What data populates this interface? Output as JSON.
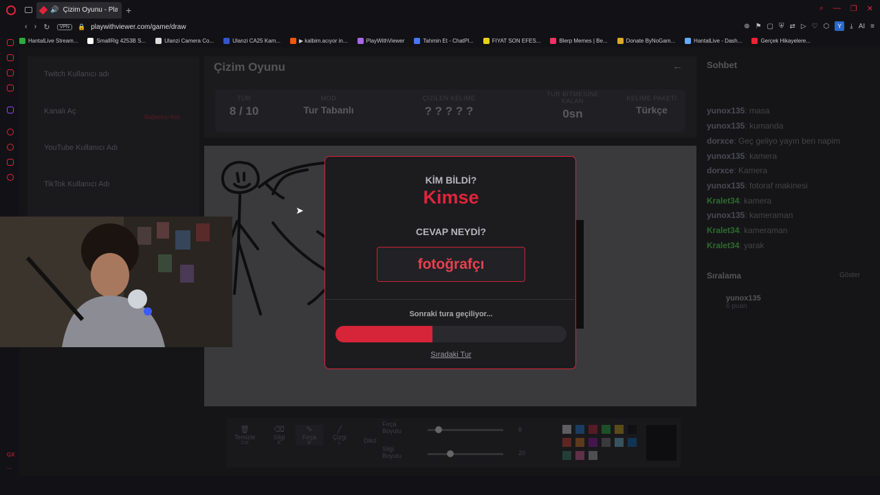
{
  "browser": {
    "tab_title": "Çizim Oyunu - PlayWi",
    "url": "playwithviewer.com/game/draw",
    "vpn_label": "VPN",
    "ai_label": "AI",
    "profile_letter": "Y"
  },
  "bookmarks": [
    {
      "label": "HantalLive Stream...",
      "color": "#2eaa3a"
    },
    {
      "label": "SmallRig 4253B S...",
      "color": "#ffffff"
    },
    {
      "label": "Ulanzi Camera Co...",
      "color": "#dddddd"
    },
    {
      "label": "Ulanzi CA25 Kam...",
      "color": "#3355cc"
    },
    {
      "label": "▶ kalbim.acıyor in...",
      "color": "#ff5500"
    },
    {
      "label": "PlayWithViewer",
      "color": "#aa66ee"
    },
    {
      "label": "Tahmin Et - ChatPl...",
      "color": "#4477ff"
    },
    {
      "label": "FIYAT SON EFES...",
      "color": "#e6d21a"
    },
    {
      "label": "Blerp Memes | Be...",
      "color": "#ee3366"
    },
    {
      "label": "Donate ByNoGam...",
      "color": "#ddaa22"
    },
    {
      "label": "HantalLive - Dash...",
      "color": "#66aaff"
    },
    {
      "label": "Gerçek Hikayelere...",
      "color": "#ee2233"
    }
  ],
  "sidebar_bottom": {
    "label": "GX",
    "more": "..."
  },
  "left_panel": {
    "twitch_label": "Twitch Kullanıcı adı",
    "channel_label": "Kanalı Aç",
    "connected_hint": "Bağlantıyı Kes",
    "youtube_label": "YouTube Kullanıcı Adı",
    "tiktok_label": "TikTok Kullanıcı Adı"
  },
  "game": {
    "title": "Çizim Oyunu",
    "stats": [
      {
        "label": "TUR",
        "value": "8 / 10"
      },
      {
        "label": "MOD",
        "value": "Tur Tabanlı"
      },
      {
        "label": "ÇİZİLEN KELİME",
        "value": "? ? ? ? ?"
      },
      {
        "label": "TUR BİTMESİNE KALAN",
        "value": "0sn"
      },
      {
        "label": "KELİME PAKETİ",
        "value": "Türkçe"
      }
    ]
  },
  "toolbar": {
    "tools": [
      {
        "label": "Temizle",
        "key": "Ctrl",
        "icon": "trash-icon"
      },
      {
        "label": "Silgi",
        "key": "E",
        "icon": "eraser-icon"
      },
      {
        "label": "Fırça",
        "key": "B",
        "icon": "brush-icon"
      },
      {
        "label": "Çizgi",
        "key": "L",
        "icon": "line-icon"
      },
      {
        "label": "Dikd",
        "key": "",
        "icon": ""
      }
    ],
    "brush_size_label": "Fırça Boyutu",
    "brush_size_value": "8",
    "brush_size_fraction": 0.1,
    "eraser_size_label": "Silgi Boyutu",
    "eraser_size_value": "20",
    "eraser_size_fraction": 0.25,
    "palette": [
      "#ffffff",
      "#1e90ff",
      "#e0243a",
      "#2ecc40",
      "#f1c40f",
      "#000000",
      "#ff4136",
      "#ff851b",
      "#b10dc9",
      "#888888",
      "#7fdbff",
      "#0074d9",
      "#3d9970",
      "#ff69b4",
      "#cccccc"
    ]
  },
  "chat": {
    "title": "Sohbet",
    "messages": [
      {
        "user": "yunox135",
        "text": "masa",
        "color": "#4a4a55"
      },
      {
        "user": "yunox135",
        "text": "kumanda",
        "color": "#4a4a55"
      },
      {
        "user": "dorxce",
        "text": "Geç geliyo yayın ben napim",
        "color": "#4a4a55"
      },
      {
        "user": "yunox135",
        "text": "kamera",
        "color": "#4a4a55"
      },
      {
        "user": "dorxce",
        "text": "Kamera",
        "color": "#4a4a55"
      },
      {
        "user": "yunox135",
        "text": "fotoraf makinesi",
        "color": "#4a4a55"
      },
      {
        "user": "Kralet34",
        "text": "kamera",
        "color": "#2f6a2f"
      },
      {
        "user": "yunox135",
        "text": "kameraman",
        "color": "#4a4a55"
      },
      {
        "user": "Kralet34",
        "text": "kameraman",
        "color": "#2f6a2f"
      },
      {
        "user": "Kralet34",
        "text": "yarak",
        "color": "#2f6a2f"
      }
    ],
    "ranking_title": "Sıralama",
    "ranking_show": "Göster",
    "ranking": [
      {
        "user": "yunox135",
        "points": "6 puan"
      }
    ]
  },
  "modal": {
    "who_guessed_label": "KİM BİLDİ?",
    "winner": "Kimse",
    "answer_label": "CEVAP NEYDİ?",
    "answer": "fotoğrafçı",
    "next_round_text": "Sonraki tura geçiliyor...",
    "progress": 0.42,
    "skip_label": "Sıradaki Tur"
  }
}
